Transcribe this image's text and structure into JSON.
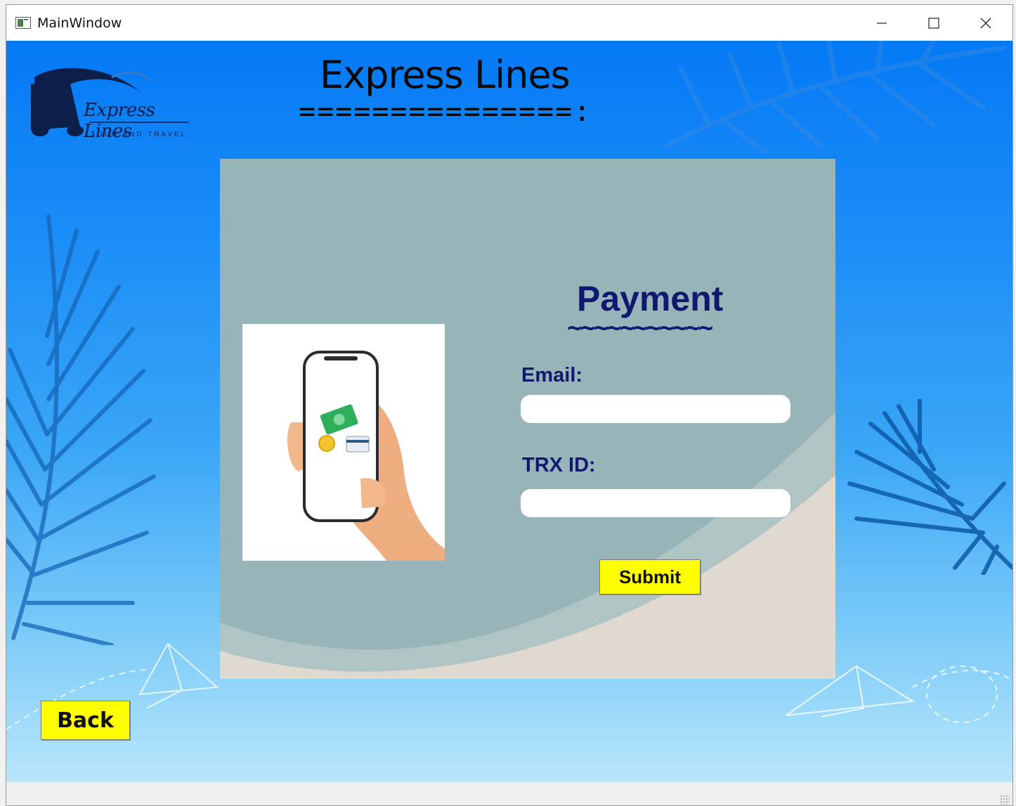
{
  "window": {
    "title": "MainWindow"
  },
  "header": {
    "title": "Express Lines",
    "rule": "===============:"
  },
  "logo": {
    "name": "Express Lines",
    "tagline": "TOUR AND TRAVEL"
  },
  "payment": {
    "title": "Payment",
    "squiggle": "~~~~~~~~~~~",
    "email_label": "Email:",
    "email_value": "",
    "trx_label": "TRX ID:",
    "trx_value": "",
    "submit_label": "Submit"
  },
  "nav": {
    "back_label": "Back"
  },
  "colors": {
    "accent_button": "#ffff00",
    "label_text": "#111870",
    "panel": "#97b5b9",
    "background_top": "#0479f5"
  }
}
